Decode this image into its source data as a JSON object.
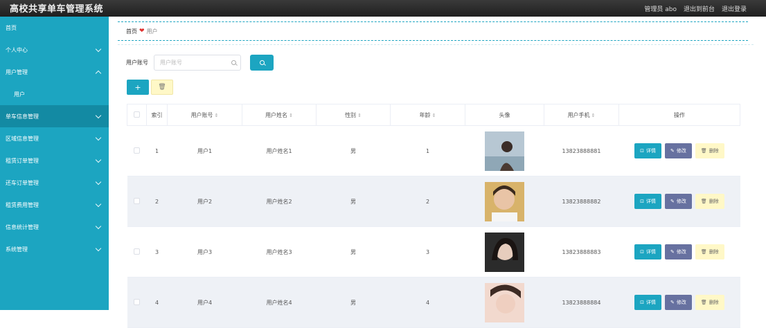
{
  "app": {
    "title": "高校共享单车管理系统"
  },
  "header": {
    "user": "管理员 abo",
    "to_front": "退出到前台",
    "logout": "退出登录"
  },
  "sidebar": {
    "items": [
      {
        "label": "首页"
      },
      {
        "label": "个人中心"
      },
      {
        "label": "用户管理"
      },
      {
        "label": "用户"
      },
      {
        "label": "单车信息管理"
      },
      {
        "label": "区域信息管理"
      },
      {
        "label": "租赁订单管理"
      },
      {
        "label": "还车订单管理"
      },
      {
        "label": "租赁费用管理"
      },
      {
        "label": "信息统计管理"
      },
      {
        "label": "系统管理"
      }
    ]
  },
  "breadcrumb": {
    "home": "首页",
    "heart_text": "❤",
    "current": "用户"
  },
  "search": {
    "label": "用户账号",
    "placeholder": "用户账号"
  },
  "toolbar": {
    "add": "+",
    "delete": "🗑"
  },
  "table": {
    "headers": {
      "index": "索引",
      "account": "用户账号",
      "name": "用户姓名",
      "gender": "性别",
      "age": "年龄",
      "avatar": "头像",
      "phone": "用户手机",
      "ops": "操作"
    },
    "rows": [
      {
        "index": "1",
        "account": "用户1",
        "name": "用户姓名1",
        "gender": "男",
        "age": "1",
        "phone": "13823888881"
      },
      {
        "index": "2",
        "account": "用户2",
        "name": "用户姓名2",
        "gender": "男",
        "age": "2",
        "phone": "13823888882"
      },
      {
        "index": "3",
        "account": "用户3",
        "name": "用户姓名3",
        "gender": "男",
        "age": "3",
        "phone": "13823888883"
      },
      {
        "index": "4",
        "account": "用户4",
        "name": "用户姓名4",
        "gender": "男",
        "age": "4",
        "phone": "13823888884"
      }
    ],
    "actions": {
      "view": "详情",
      "edit": "修改",
      "remove": "删除"
    }
  },
  "colors": {
    "accent": "#1ca5c1",
    "edit": "#6771a0",
    "remove_bg": "#fff8c7",
    "sidebar_active": "#138aa3"
  }
}
